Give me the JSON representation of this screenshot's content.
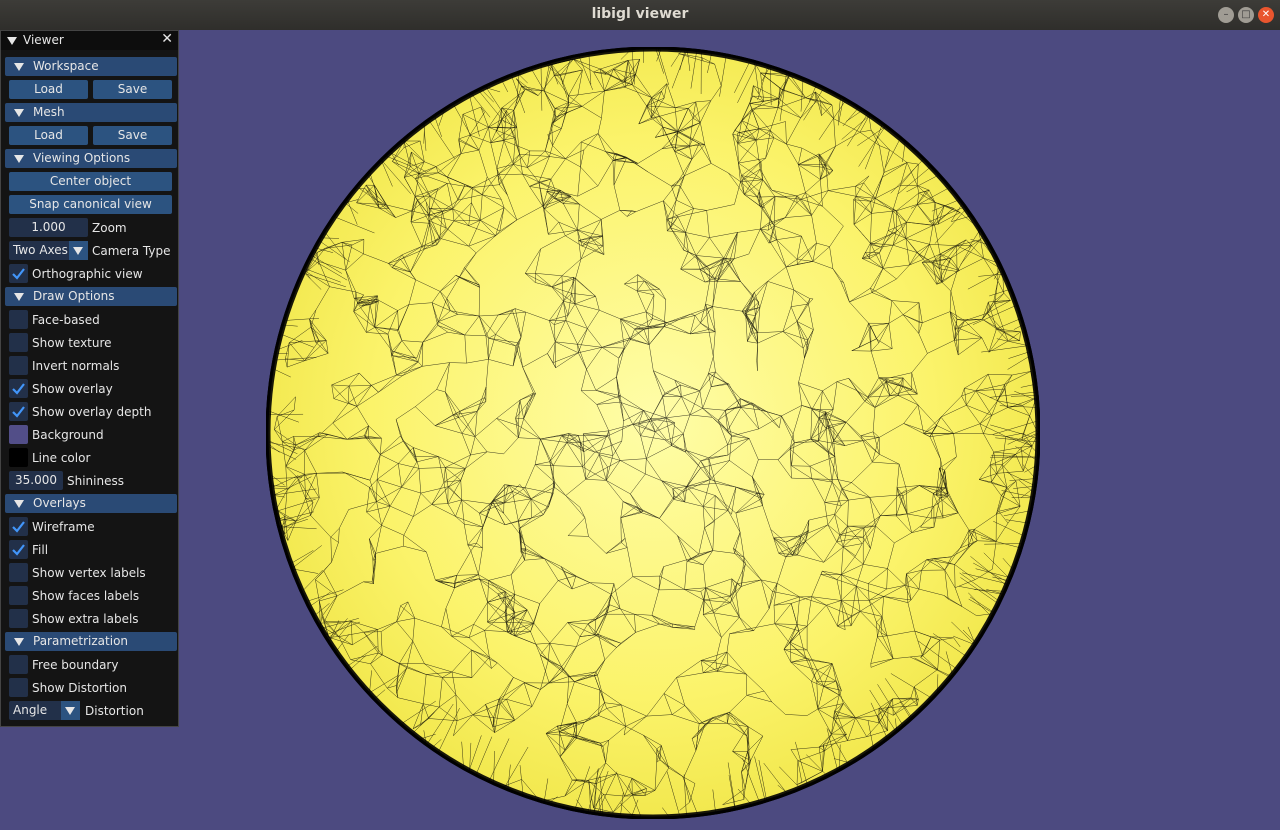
{
  "window": {
    "title": "libigl viewer"
  },
  "panel": {
    "title": "Viewer",
    "sections": {
      "workspace": {
        "label": "Workspace",
        "load": "Load",
        "save": "Save"
      },
      "mesh": {
        "label": "Mesh",
        "load": "Load",
        "save": "Save"
      },
      "viewing": {
        "label": "Viewing Options",
        "center": "Center object",
        "snap": "Snap canonical view",
        "zoom_value": "1.000",
        "zoom_label": "Zoom",
        "camera_value": "Two Axes",
        "camera_label": "Camera Type",
        "ortho_label": "Orthographic view",
        "ortho_checked": true
      },
      "draw": {
        "label": "Draw Options",
        "face_based": "Face-based",
        "show_texture": "Show texture",
        "invert_normals": "Invert normals",
        "show_overlay": "Show overlay",
        "show_overlay_depth": "Show overlay depth",
        "background": "Background",
        "line_color": "Line color",
        "shininess_value": "35.000",
        "shininess_label": "Shininess",
        "background_color": "#524e88",
        "line_color_value": "#000000"
      },
      "overlays": {
        "label": "Overlays",
        "wireframe": "Wireframe",
        "fill": "Fill",
        "vertex_labels": "Show vertex labels",
        "faces_labels": "Show faces labels",
        "extra_labels": "Show extra labels"
      },
      "param": {
        "label": "Parametrization",
        "free_boundary": "Free boundary",
        "show_distortion": "Show Distortion",
        "distortion_value": "Angle",
        "distortion_label": "Distortion"
      }
    }
  },
  "colors": {
    "mesh_fill": "#ffff66",
    "viewport_bg": "#4c4a80",
    "accent": "#2c5380"
  }
}
